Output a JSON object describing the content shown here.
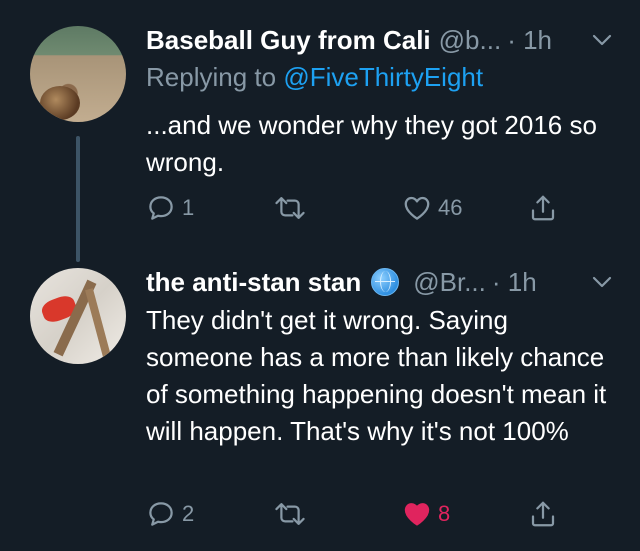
{
  "tweets": [
    {
      "display_name": "Baseball Guy from Cali",
      "handle": "@b...",
      "time": "· 1h",
      "reply_prefix": "Replying to ",
      "reply_to": "@FiveThirtyEight",
      "text": "...and we wonder why they got 2016 so wrong.",
      "reply_count": "1",
      "like_count": "46",
      "liked": false,
      "avatar_icon": "baseball-photo-avatar"
    },
    {
      "display_name": "the anti-stan stan",
      "handle": "@Br...",
      "time": "· 1h",
      "text": "They didn't get it wrong. Saying someone has a more than likely chance of something happening doesn't mean it will happen. That's why it's not 100%",
      "reply_count": "2",
      "like_count": "8",
      "liked": true,
      "name_emoji": "globe-icon",
      "avatar_icon": "crab-photo-avatar"
    }
  ],
  "colors": {
    "background": "#141d26",
    "secondary_text": "#8899a6",
    "link": "#1da1f2",
    "like": "#e0245e"
  }
}
